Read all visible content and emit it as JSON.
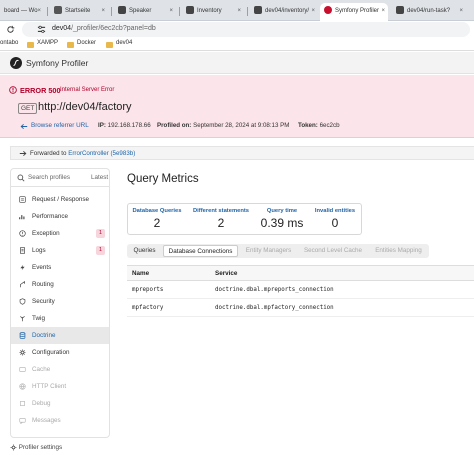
{
  "browser": {
    "tabs": [
      {
        "label": "board — Wo",
        "icon_color": "#888888"
      },
      {
        "label": "Startseite",
        "icon_color": "#555555"
      },
      {
        "label": "Speaker",
        "icon_color": "#333333"
      },
      {
        "label": "Inventory",
        "icon_color": "#333333"
      },
      {
        "label": "dev04/inventory/",
        "icon_color": "#333333"
      },
      {
        "label": "Symfony Profiler",
        "icon_color": "#c8102e"
      },
      {
        "label": "dev04/run-task?",
        "icon_color": "#333333"
      }
    ],
    "close_glyph": "×",
    "url_host": "dev04",
    "url_path": "/_profiler/6ec2cb?panel=db",
    "bookmarks": [
      "ontabo",
      "XAMPP",
      "Docker",
      "dev04"
    ]
  },
  "profiler": {
    "brand": "Symfony Profiler",
    "error_code": "ERROR 500",
    "error_text": "Internal Server Error",
    "method": "GET",
    "url": "http://dev04/factory",
    "browse_link": "Browse referrer URL",
    "ip_label": "IP:",
    "ip": "192.168.178.66",
    "profiled_label": "Profiled on:",
    "profiled": "September 28, 2024 at 9:08:13 PM",
    "token_label": "Token:",
    "token": "6ec2cb",
    "forwarded_prefix": "Forwarded to",
    "forwarded_link": "ErrorController (5e983b)"
  },
  "sidebar": {
    "search_placeholder": "Search profiles",
    "latest": "Latest",
    "items": [
      {
        "label": "Request / Response",
        "badge": ""
      },
      {
        "label": "Performance",
        "badge": ""
      },
      {
        "label": "Exception",
        "badge": "1"
      },
      {
        "label": "Logs",
        "badge": "1"
      },
      {
        "label": "Events",
        "badge": ""
      },
      {
        "label": "Routing",
        "badge": ""
      },
      {
        "label": "Security",
        "badge": ""
      },
      {
        "label": "Twig",
        "badge": ""
      },
      {
        "label": "Doctrine",
        "badge": ""
      },
      {
        "label": "Configuration",
        "badge": ""
      },
      {
        "label": "Cache",
        "badge": ""
      },
      {
        "label": "HTTP Client",
        "badge": ""
      },
      {
        "label": "Debug",
        "badge": ""
      },
      {
        "label": "Messages",
        "badge": ""
      }
    ],
    "settings": "Profiler settings"
  },
  "main": {
    "title": "Query Metrics",
    "metrics": [
      {
        "label": "Database Queries",
        "value": "2"
      },
      {
        "label": "Different statements",
        "value": "2"
      },
      {
        "label": "Query time",
        "value": "0.39 ms"
      },
      {
        "label": "Invalid entities",
        "value": "0"
      }
    ],
    "tabs": [
      "Queries",
      "Database Connections",
      "Entity Managers",
      "Second Level Cache",
      "Entities Mapping"
    ],
    "table": {
      "headers": [
        "Name",
        "Service"
      ],
      "rows": [
        [
          "mpreports",
          "doctrine.dbal.mpreports_connection"
        ],
        [
          "mpfactory",
          "doctrine.dbal.mpfactory_connection"
        ]
      ]
    }
  },
  "colors": {
    "error_bg": "#fbe4ea",
    "error_red": "#b0002a",
    "link": "#1f64a8",
    "doctrine_sel": "#e8e8e8"
  }
}
